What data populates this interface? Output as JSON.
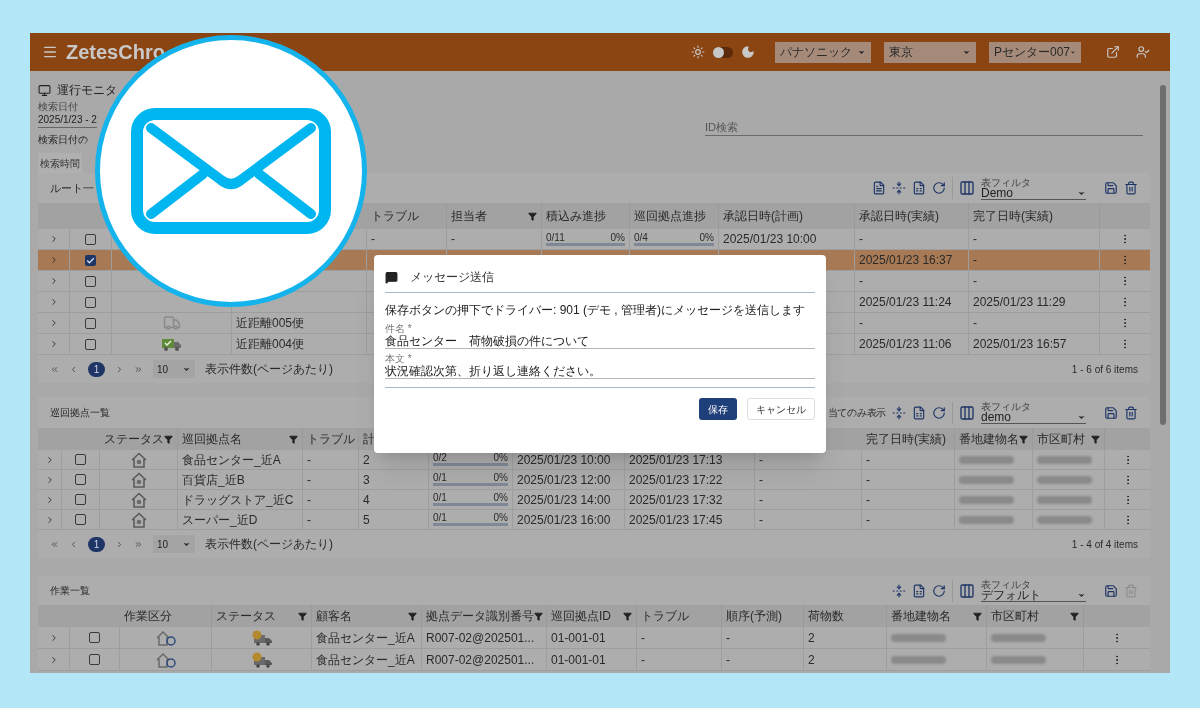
{
  "app_bar": {
    "title": "ZetesChro",
    "dark_mode": false,
    "selects": [
      "パナソニック",
      "東京",
      "Pセンター007"
    ]
  },
  "page": {
    "title": "運行モニタ",
    "date_label": "検索日付",
    "date_value": "2025/1/23 - 2",
    "date_hint": "検索日付の",
    "time_tab": "検索時間",
    "id_search_placeholder": "ID検索"
  },
  "routes": {
    "title": "ルート一",
    "filter_label": "表フィルタ",
    "filter_value": "Demo",
    "columns": [
      {
        "label": "トラブル",
        "filter": false
      },
      {
        "label": "担当者",
        "filter": true
      },
      {
        "label": "積込み進捗",
        "filter": false
      },
      {
        "label": "巡回拠点進捗",
        "filter": false
      },
      {
        "label": "承認日時(計画)",
        "filter": false
      },
      {
        "label": "承認日時(実績)",
        "filter": false
      },
      {
        "label": "完了日時(実績)",
        "filter": false
      }
    ],
    "rows": [
      {
        "selected": false,
        "checked": false,
        "trouble": "-",
        "assignee": "-",
        "loading": {
          "text": "0/11",
          "percent": "0%",
          "level": 0
        },
        "visits": {
          "text": "0/4",
          "percent": "0%",
          "level": 0
        },
        "plan": "2025/01/23 10:00",
        "actual": "-",
        "done": "-"
      },
      {
        "selected": true,
        "checked": true,
        "actual": "2025/01/23 16:37",
        "done": "-"
      },
      {
        "selected": false,
        "checked": false,
        "actual": "-",
        "done": "-"
      },
      {
        "selected": false,
        "checked": false,
        "actual": "2025/01/23 11:24",
        "done": "2025/01/23 11:29"
      },
      {
        "selected": false,
        "checked": false,
        "delivered": false,
        "name": "近距離005便",
        "actual": "-",
        "done": "-"
      },
      {
        "selected": false,
        "checked": false,
        "delivered": true,
        "name": "近距離004便",
        "actual": "2025/01/23 11:06",
        "done": "2025/01/23 16:57"
      }
    ],
    "page": "1",
    "page_size": "10",
    "page_size_label": "表示件数(ページあたり)",
    "summary": "1 - 6 of 6 items"
  },
  "stops": {
    "title": "巡回拠点一覧",
    "assigned_only": "当てのみ表示",
    "filter_label": "表フィルタ",
    "filter_value": "demo",
    "columns": [
      {
        "label": "ステータス",
        "filter": true
      },
      {
        "label": "巡回拠点名",
        "filter": true
      },
      {
        "label": "トラブル",
        "filter": false
      },
      {
        "label": "計"
      },
      {
        "label": "完了日時(実績)",
        "filter": false
      },
      {
        "label": "番地建物名",
        "filter": true
      },
      {
        "label": "市区町村",
        "filter": true
      }
    ],
    "rows": [
      {
        "checked": false,
        "name": "食品センター_近A",
        "trouble": "-",
        "count": "2",
        "progress": {
          "text": "0/2",
          "percent": "0%",
          "level": 0
        },
        "plan": "2025/01/23 10:00",
        "actual": "2025/01/23 17:13",
        "other": "-",
        "done": "-"
      },
      {
        "checked": false,
        "name": "百貨店_近B",
        "trouble": "-",
        "count": "3",
        "progress": {
          "text": "0/1",
          "percent": "0%",
          "level": 0
        },
        "plan": "2025/01/23 12:00",
        "actual": "2025/01/23 17:22",
        "other": "-",
        "done": "-"
      },
      {
        "checked": false,
        "name": "ドラッグストア_近C",
        "trouble": "-",
        "count": "4",
        "progress": {
          "text": "0/1",
          "percent": "0%",
          "level": 0
        },
        "plan": "2025/01/23 14:00",
        "actual": "2025/01/23 17:32",
        "other": "-",
        "done": "-"
      },
      {
        "checked": false,
        "name": "スーパー_近D",
        "trouble": "-",
        "count": "5",
        "progress": {
          "text": "0/1",
          "percent": "0%",
          "level": 0
        },
        "plan": "2025/01/23 16:00",
        "actual": "2025/01/23 17:45",
        "other": "-",
        "done": "-"
      }
    ],
    "page": "1",
    "page_size": "10",
    "page_size_label": "表示件数(ページあたり)",
    "summary": "1 - 4 of 4 items"
  },
  "tasks": {
    "title": "作業一覧",
    "filter_label": "表フィルタ",
    "filter_value": "デフォルト",
    "delete_disabled": true,
    "columns": [
      {
        "label": "作業区分",
        "filter": false
      },
      {
        "label": "ステータス",
        "filter": true
      },
      {
        "label": "顧客名",
        "filter": true
      },
      {
        "label": "拠点データ識別番号",
        "filter": true
      },
      {
        "label": "巡回拠点ID",
        "filter": true
      },
      {
        "label": "トラブル",
        "filter": false
      },
      {
        "label": "順序(予測)",
        "filter": false
      },
      {
        "label": "荷物数",
        "filter": false
      },
      {
        "label": "番地建物名",
        "filter": true
      },
      {
        "label": "市区町村",
        "filter": true
      }
    ],
    "rows": [
      {
        "checked": false,
        "customer": "食品センター_近A",
        "stop_data_id": "R007-02@202501...",
        "stop_id": "01-001-01",
        "trouble": "-",
        "order": "-",
        "parcels": "2"
      },
      {
        "checked": false,
        "customer": "食品センター_近A",
        "stop_data_id": "R007-02@202501...",
        "stop_id": "01-001-01",
        "trouble": "-",
        "order": "-",
        "parcels": "2"
      }
    ]
  },
  "dialog": {
    "title": "メッセージ送信",
    "description": "保存ボタンの押下でドライバー: 901 (デモ , 管理者)にメッセージを送信します",
    "fields": [
      {
        "label": "件名 *",
        "value": "食品センター　荷物破損の件について"
      },
      {
        "label": "本文 *",
        "value": "状況確認次第、折り返し連絡ください。"
      }
    ],
    "buttons": [
      {
        "label": "保存",
        "primary": true
      },
      {
        "label": "キャンセル",
        "primary": false
      }
    ]
  }
}
